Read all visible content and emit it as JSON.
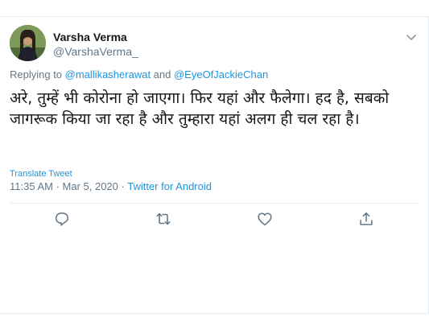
{
  "tweet": {
    "author": {
      "display_name": "Varsha Verma",
      "handle": "@VarshaVerma_"
    },
    "replying": {
      "prefix": "Replying to ",
      "user1": "@mallikasherawat",
      "conjunction": " and ",
      "user2": "@EyeOfJackieChan"
    },
    "text": "अरे, तुम्हें भी कोरोना हो जाएगा। फिर यहां और फैलेगा। हद है, सबको जागरूक किया जा रहा है और तुम्हारा यहां अलग ही चल रहा है।",
    "translate_label": "Translate Tweet",
    "time": "11:35 AM · Mar 5, 2020 · ",
    "source": "Twitter for Android"
  },
  "icons": {
    "more": "chevron-down-icon",
    "reply": "reply-icon",
    "retweet": "retweet-icon",
    "like": "like-icon",
    "share": "share-icon"
  },
  "colors": {
    "link": "#1b95e0",
    "secondary_text": "#657786",
    "border": "#e6ecf0"
  }
}
